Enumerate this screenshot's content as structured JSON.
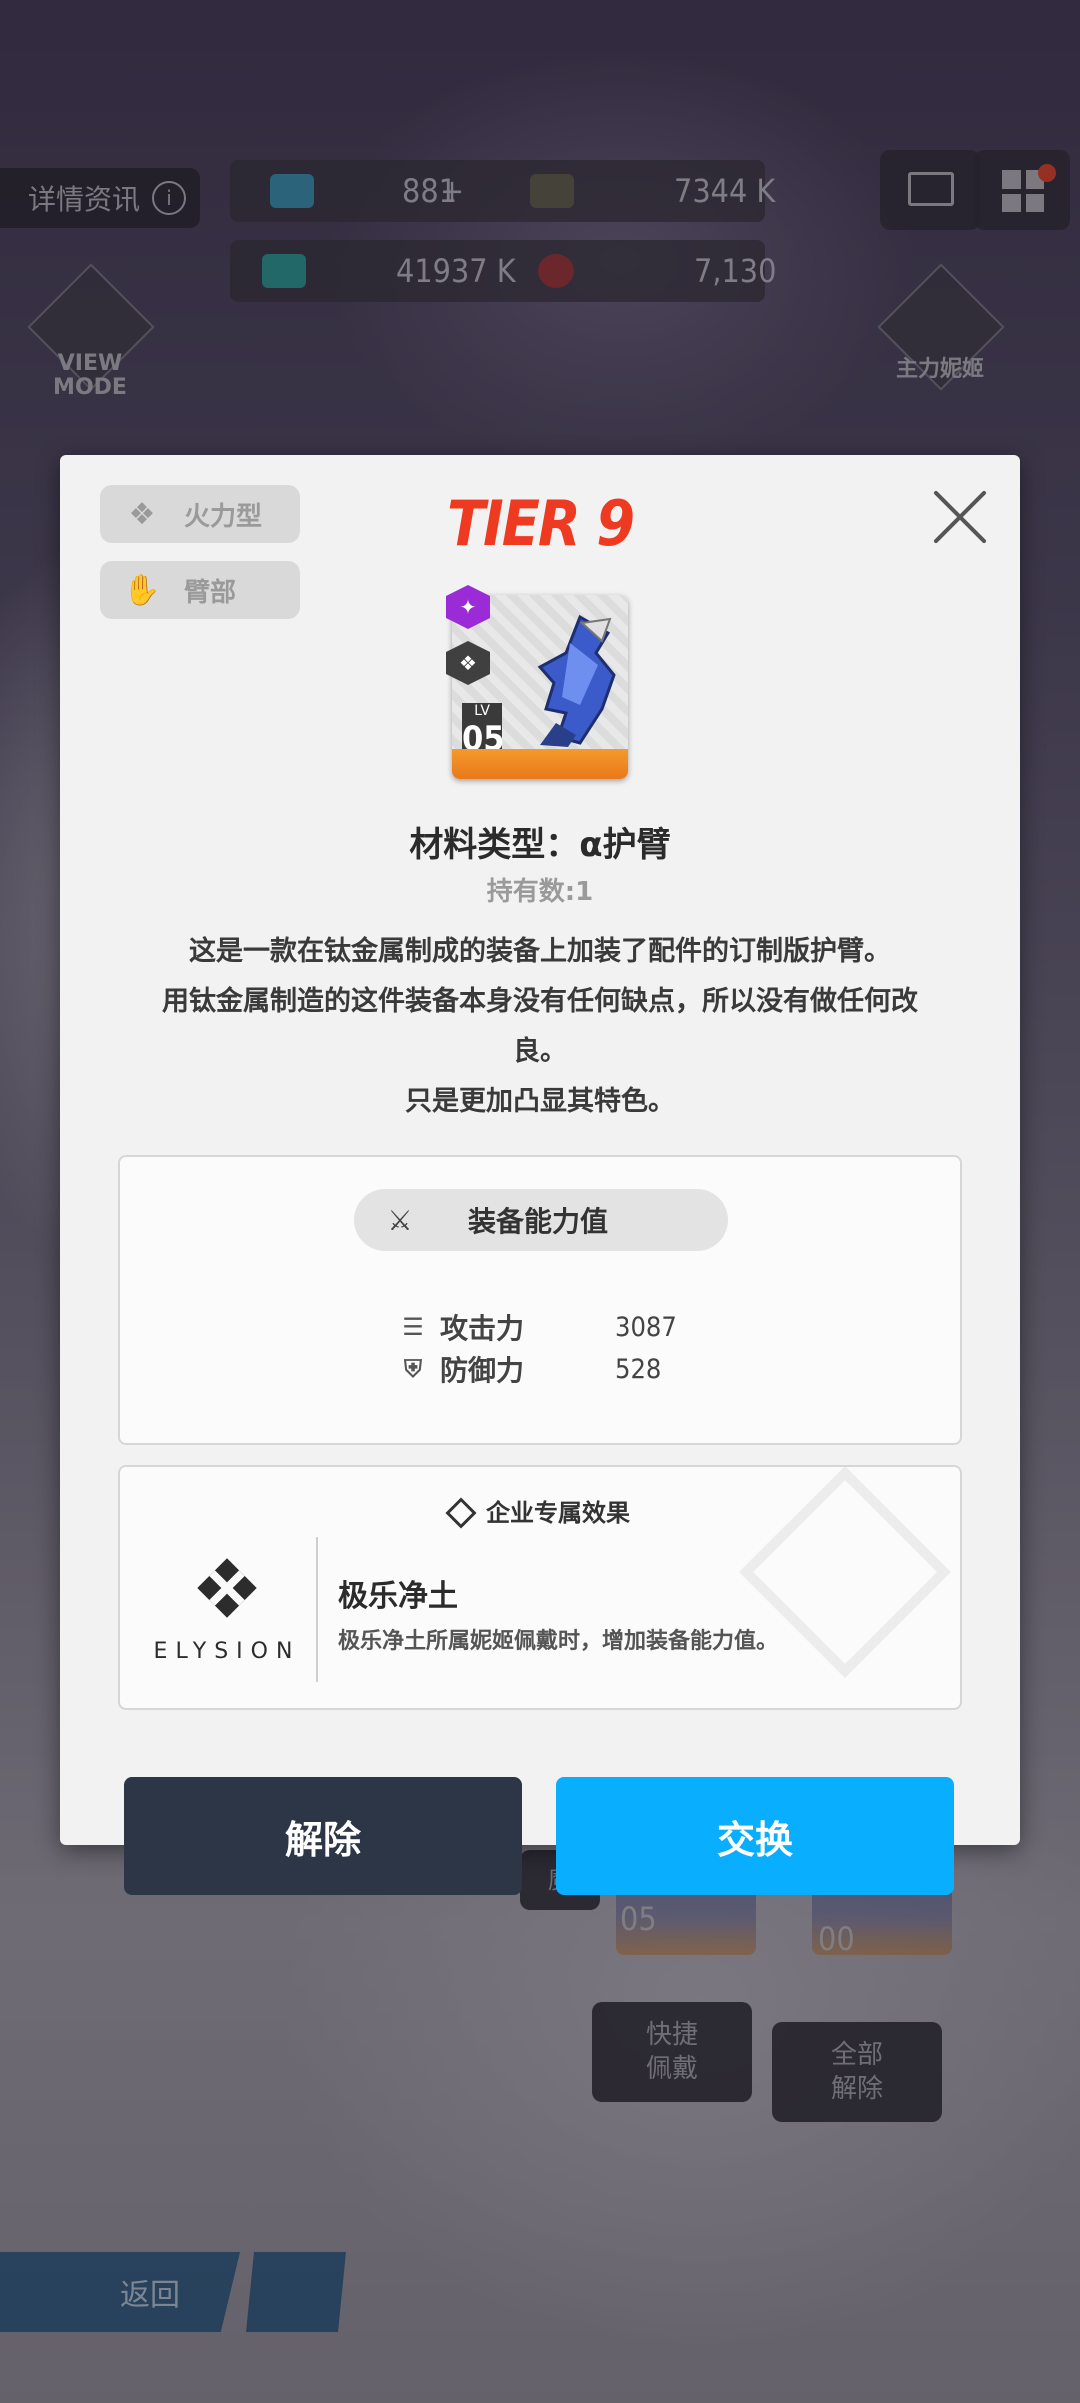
{
  "hud": {
    "details_label": "详情资讯",
    "gems": "881",
    "gems_plus": "+",
    "credits": "7344 K",
    "battle_data": "41937 K",
    "core_dust": "7,130",
    "view_mode_label": "VIEW\nMODE",
    "main_nikke_label": "主力妮姬"
  },
  "background": {
    "slot_levels": [
      "05",
      "00"
    ],
    "quick_equip": "快捷\n佩戴",
    "unequip_all": "全部\n解除",
    "back": "返回",
    "partial_text": "魔"
  },
  "modal": {
    "tags": [
      {
        "label": "火力型",
        "icon": "firepower-class-icon"
      },
      {
        "label": "臂部",
        "icon": "arm-slot-icon"
      }
    ],
    "tier": "TIER 9",
    "item": {
      "level_prefix": "LV",
      "level": "05",
      "rarity_color": "#9b2bd6",
      "bottom_color": "#f08a22"
    },
    "title": "材料类型：α护臂",
    "owned": "持有数:1",
    "description": [
      "这是一款在钛金属制成的装备上加装了配件的订制版护臂。",
      "用钛金属制造的这件装备本身没有任何缺点，所以没有做任何改",
      "良。",
      "只是更加凸显其特色。"
    ],
    "stats": {
      "header": "装备能力值",
      "rows": [
        {
          "label": "攻击力",
          "value": "3087",
          "icon": "attack-icon"
        },
        {
          "label": "防御力",
          "value": "528",
          "icon": "shield-icon"
        }
      ]
    },
    "corp": {
      "header": "企业专属效果",
      "logo_word": "ELYSION",
      "name": "极乐净土",
      "desc": "极乐净土所属妮姬佩戴时，增加装备能力值。"
    },
    "buttons": {
      "release": "解除",
      "swap": "交换"
    },
    "accent_colors": {
      "tier": "#ee3a20",
      "swap": "#0aaeff",
      "release": "#2d3646"
    }
  }
}
